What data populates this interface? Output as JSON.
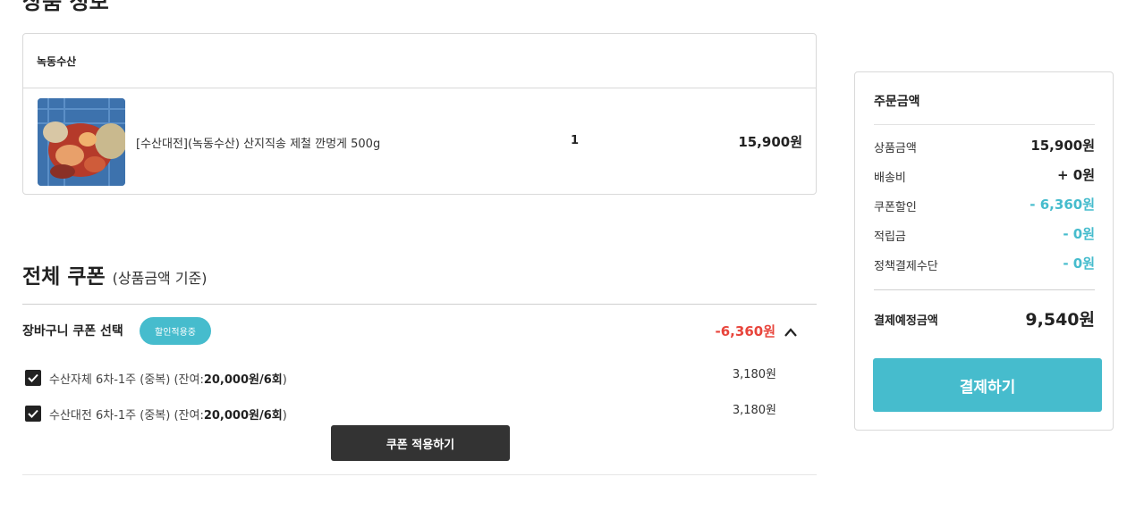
{
  "product_section": {
    "title": "상품 정보",
    "seller": "녹동수산",
    "item": {
      "name": "[수산대전](녹동수산) 산지직송 제철 깐멍게 500g",
      "quantity": "1",
      "price": "15,900원"
    }
  },
  "coupon_section": {
    "title": "전체 쿠폰",
    "subtitle": "(상품금액 기준)",
    "cart_coupon_label": "장바구니 쿠폰 선택",
    "applied_badge": "할인적용중",
    "discount_total": "-6,360원",
    "coupons": [
      {
        "name": "수산자체 6차-1주 (중복)",
        "remaining_prefix": "(잔여:",
        "remaining_value": "20,000원/6회",
        "remaining_suffix": ")",
        "amount": "3,180원",
        "checked": true
      },
      {
        "name": "수산대전 6차-1주 (중복)",
        "remaining_prefix": "(잔여:",
        "remaining_value": "20,000원/6회",
        "remaining_suffix": ")",
        "amount": "3,180원",
        "checked": true
      }
    ],
    "apply_button": "쿠폰 적용하기"
  },
  "order_summary": {
    "title": "주문금액",
    "rows": [
      {
        "label": "상품금액",
        "value": "15,900원"
      },
      {
        "label": "배송비",
        "value": "+ 0원"
      },
      {
        "label": "쿠폰할인",
        "value": "- 6,360원"
      },
      {
        "label": "적립금",
        "value": "- 0원"
      },
      {
        "label": "정책결제수단",
        "value": "- 0원"
      }
    ],
    "total_label": "결제예정금액",
    "total_value": "9,540원",
    "pay_button": "결제하기"
  },
  "colors": {
    "accent": "#46bccd",
    "discount_red": "#e8453c",
    "dark_button": "#333333"
  },
  "icons": {
    "collapse": "chevron-up-icon",
    "checkbox": "checkmark-icon"
  }
}
